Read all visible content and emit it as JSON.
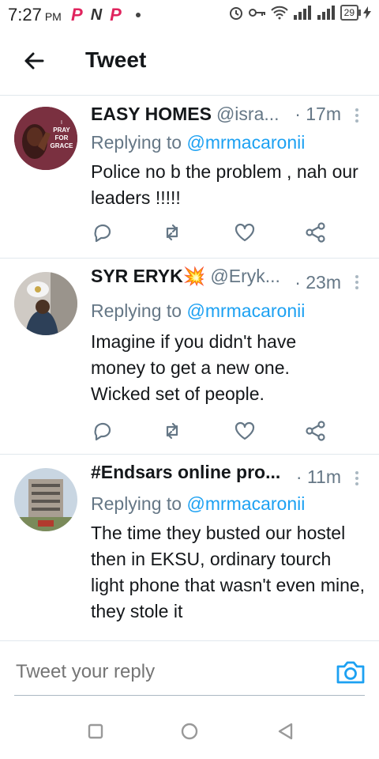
{
  "status_bar": {
    "time": "7:27",
    "ampm": "PM",
    "battery": "29"
  },
  "header": {
    "title": "Tweet"
  },
  "tweets": [
    {
      "name": "EASY HOMES",
      "handle": "@isra...",
      "time": "· 17m",
      "reply_label": "Replying to ",
      "reply_handle": "@mrmacaronii",
      "text": "Police no b the problem , nah our leaders !!!!!",
      "avatar_text": "I PRAY FOR GRACE"
    },
    {
      "name": "SYR ERYK💥",
      "handle": "@Eryk...",
      "time": "· 23m",
      "reply_label": "Replying to ",
      "reply_handle": "@mrmacaronii",
      "text": "Imagine if you didn't have money to get a new one. Wicked set of people."
    },
    {
      "name": "#Endsars online pro...",
      "handle": "",
      "time": "· 11m",
      "reply_label": "Replying to ",
      "reply_handle": "@mrmacaronii",
      "text": "The time they busted our hostel then in EKSU, ordinary tourch light phone that wasn't even mine, they stole it"
    }
  ],
  "reply_bar": {
    "placeholder": "Tweet your reply"
  },
  "colors": {
    "accent": "#1da1f2",
    "muted": "#657786",
    "icon": "#657786"
  }
}
